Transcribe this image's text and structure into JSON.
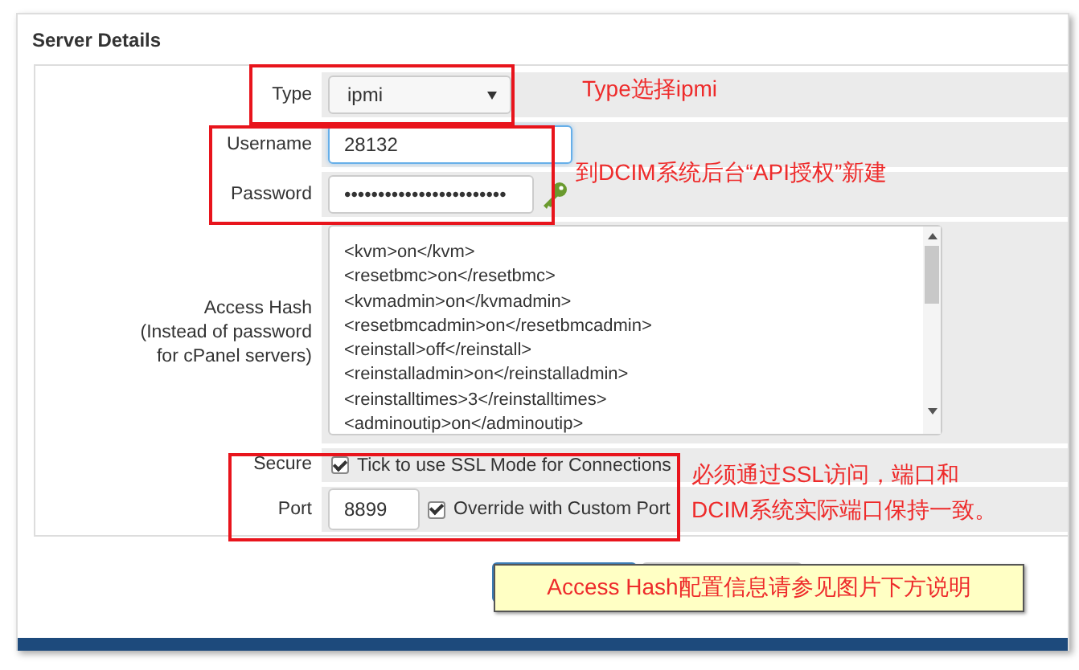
{
  "section_title": "Server Details",
  "fields": [
    {
      "kind": "select",
      "label": "Type",
      "value": "ipmi"
    },
    {
      "kind": "text",
      "label": "Username",
      "value": "28132",
      "focused": true
    },
    {
      "kind": "password",
      "label": "Password",
      "value": "••••••••••••••••••••••••"
    },
    {
      "kind": "textarea",
      "label": "Access Hash",
      "sublabel": [
        "(Instead of password",
        "for cPanel servers)"
      ],
      "lines": [
        "<kvm>on</kvm>",
        "<resetbmc>on</resetbmc>",
        "<kvmadmin>on</kvmadmin>",
        "<resetbmcadmin>on</resetbmcadmin>",
        "<reinstall>off</reinstall>",
        "<reinstalladmin>on</reinstalladmin>",
        "<reinstalltimes>3</reinstalltimes>",
        "<adminoutip>on</adminoutip>"
      ]
    },
    {
      "kind": "checkbox",
      "label": "Secure",
      "checked": true,
      "text": "Tick to use SSL Mode for Connections"
    },
    {
      "kind": "port",
      "label": "Port",
      "value": "8899",
      "checked": true,
      "text": "Override with Custom Port"
    }
  ],
  "annotations": [
    {
      "lines": [
        "Type选择ipmi"
      ]
    },
    {
      "lines": [
        "到DCIM系统后台“API授权”新建"
      ]
    },
    {
      "lines": [
        "必须通过SSL访问，端口和",
        "DCIM系统实际端口保持一致。"
      ]
    }
  ],
  "note": "Access Hash配置信息请参见图片下方说明"
}
